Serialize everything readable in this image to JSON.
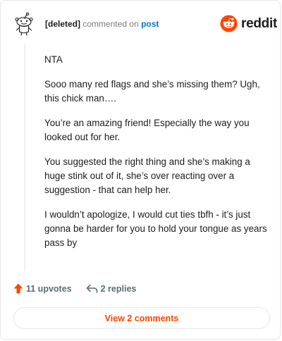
{
  "comment": {
    "author": "[deleted]",
    "action": "commented on",
    "link_text": "post",
    "paragraphs": [
      "NTA",
      "Sooo many red flags and she’s missing them? Ugh, this chick man….",
      "You’re an amazing friend! Especially the way you looked out for her.",
      "You suggested the right thing and she’s making a huge stink out of it, she’s over reacting over a suggestion - that can help her.",
      "I wouldn’t apologize, I would cut ties tbfh - it’s just gonna be harder for you to hold your tongue as years pass by"
    ]
  },
  "brand": {
    "wordmark": "reddit",
    "icon": "reddit-snoo-icon",
    "color": "#ff4500"
  },
  "footer": {
    "upvotes_label": "11 upvotes",
    "upvote_icon": "upvote-arrow-icon",
    "replies_label": "2 replies",
    "reply_icon": "reply-arrow-icon"
  },
  "view_comments_label": "View 2 comments",
  "colors": {
    "accent": "#ff4500",
    "link": "#0079d3",
    "muted": "#7c7c7c"
  }
}
